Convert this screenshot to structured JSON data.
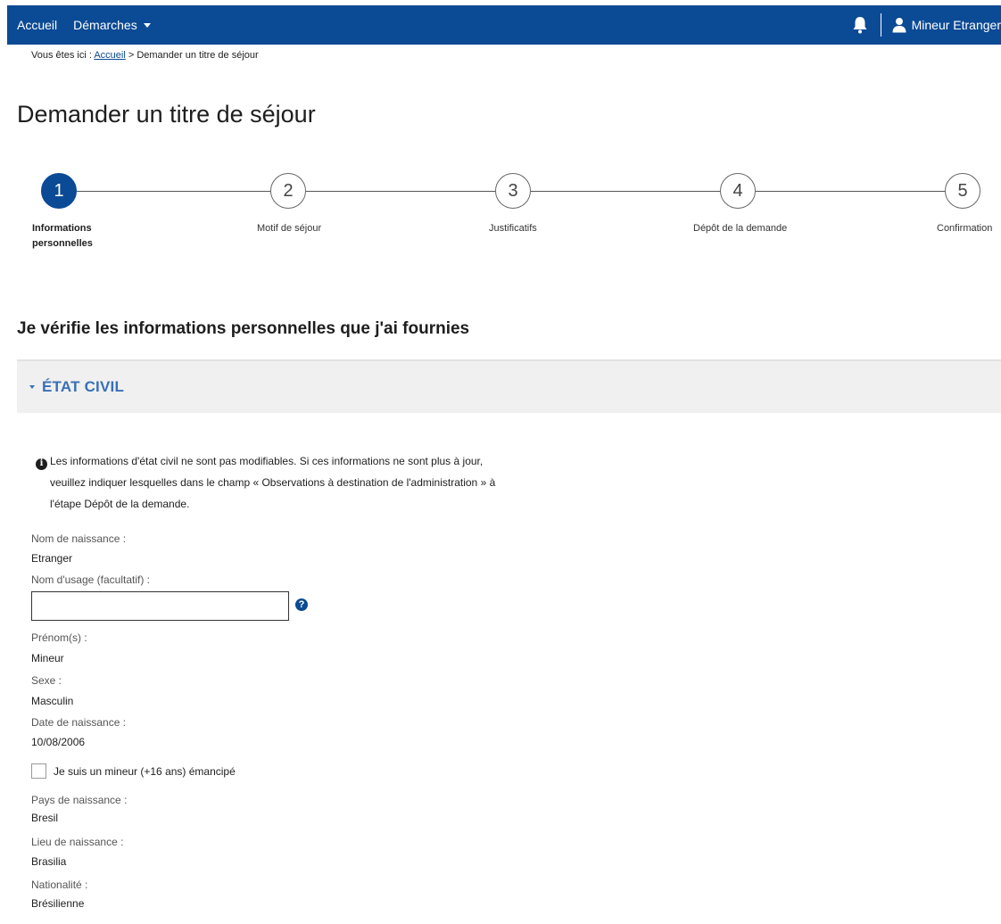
{
  "nav": {
    "home": "Accueil",
    "procedures": "Démarches",
    "user": "Mineur Etranger"
  },
  "breadcrumb": {
    "prefix": "Vous êtes ici : ",
    "home": "Accueil",
    "current": " > Demander un titre de séjour"
  },
  "page": {
    "title": "Demander un titre de séjour",
    "heading": "Je vérifie les informations personnelles que j'ai fournies"
  },
  "stepper": {
    "current": 1,
    "steps": [
      {
        "number": "1",
        "label_line1": "Informations",
        "label_line2": "personnelles"
      },
      {
        "number": "2",
        "label": "Motif de séjour"
      },
      {
        "number": "3",
        "label": "Justificatifs"
      },
      {
        "number": "4",
        "label": "Dépôt de la demande"
      },
      {
        "number": "5",
        "label": "Confirmation"
      }
    ]
  },
  "accordion": {
    "title": "ÉTAT CIVIL",
    "expanded": true
  },
  "notice": {
    "line1": "Les informations d'état civil ne sont pas modifiables. Si ces informations ne sont plus à jour,",
    "line2": "veuillez indiquer lesquelles dans le champ « Observations à destination de l'administration » à",
    "line3": "l'étape Dépôt de la demande."
  },
  "fields": {
    "birth_name_label": "Nom de naissance :",
    "birth_name_value": "Etranger",
    "usage_name_label": "Nom d'usage (facultatif) :",
    "usage_name_value": "",
    "first_names_label": "Prénom(s) :",
    "first_names_value": "Mineur",
    "sex_label": "Sexe :",
    "sex_value": "Masculin",
    "birth_date_label": "Date de naissance :",
    "birth_date_value": "10/08/2006",
    "emancipated_label": "Je suis un mineur (+16 ans) émancipé",
    "emancipated_checked": false,
    "birth_country_label": "Pays de naissance :",
    "birth_country_value": "Bresil",
    "birth_place_label": "Lieu de naissance :",
    "birth_place_value": "Brasilia",
    "nationality_label": "Nationalité :",
    "nationality_value": "Brésilienne"
  },
  "colors": {
    "primary": "#0b4a94",
    "accordion_title": "#3a6fb6",
    "accordion_bg": "#f0f0f0"
  }
}
